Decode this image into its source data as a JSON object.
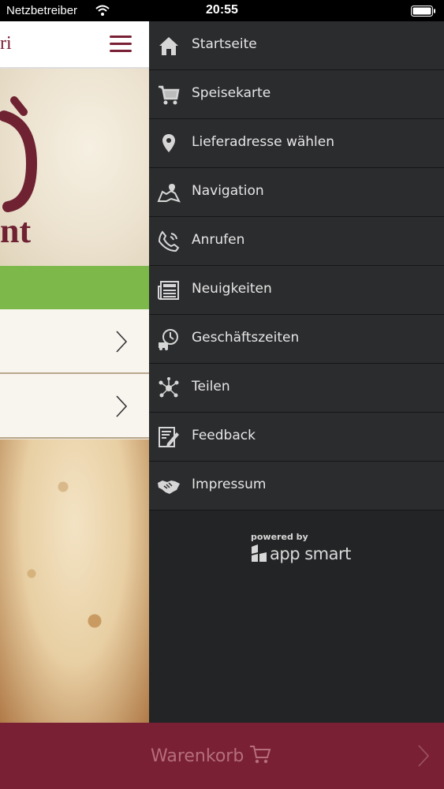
{
  "status_bar": {
    "carrier": "Netzbetreiber",
    "time": "20:55"
  },
  "background_page": {
    "title_fragment": "ri",
    "logo_fragment": "nt"
  },
  "menu": {
    "items": [
      {
        "label": "Startseite",
        "icon": "home-icon"
      },
      {
        "label": "Speisekarte",
        "icon": "cart-icon"
      },
      {
        "label": "Lieferadresse wählen",
        "icon": "location-pin-icon"
      },
      {
        "label": "Navigation",
        "icon": "map-icon"
      },
      {
        "label": "Anrufen",
        "icon": "phone-icon"
      },
      {
        "label": "Neuigkeiten",
        "icon": "newspaper-icon"
      },
      {
        "label": "Geschäftszeiten",
        "icon": "clock-truck-icon"
      },
      {
        "label": "Teilen",
        "icon": "share-icon"
      },
      {
        "label": "Feedback",
        "icon": "feedback-icon"
      },
      {
        "label": "Impressum",
        "icon": "handshake-icon"
      }
    ]
  },
  "powered_by": {
    "label": "powered by",
    "brand": "app smart"
  },
  "cart": {
    "label": "Warenkorb"
  },
  "colors": {
    "brand": "#7a2035",
    "drawer": "#2b2c2e",
    "accent_green": "#7cb84a"
  }
}
